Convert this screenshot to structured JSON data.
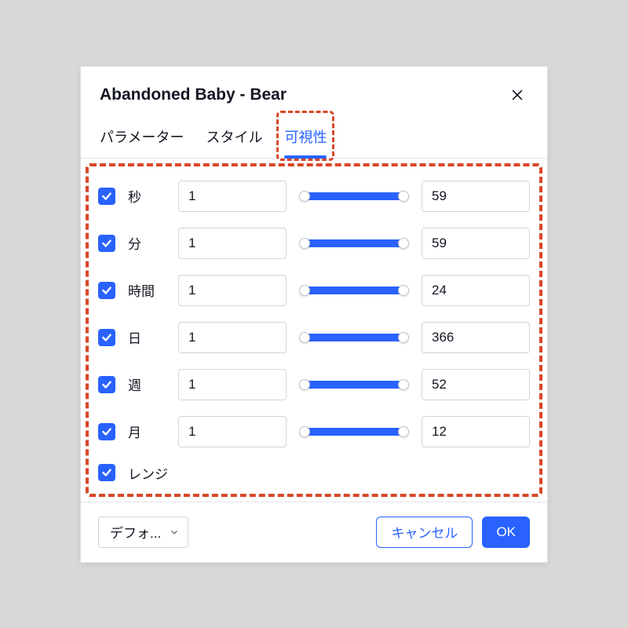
{
  "dialog": {
    "title": "Abandoned Baby - Bear"
  },
  "tabs": {
    "parameters": "パラメーター",
    "style": "スタイル",
    "visibility": "可視性"
  },
  "rows": [
    {
      "label": "秒",
      "min": "1",
      "max": "59"
    },
    {
      "label": "分",
      "min": "1",
      "max": "59"
    },
    {
      "label": "時間",
      "min": "1",
      "max": "24"
    },
    {
      "label": "日",
      "min": "1",
      "max": "366"
    },
    {
      "label": "週",
      "min": "1",
      "max": "52"
    },
    {
      "label": "月",
      "min": "1",
      "max": "12"
    }
  ],
  "range": {
    "label": "レンジ"
  },
  "footer": {
    "dropdown": "デフォ...",
    "cancel": "キャンセル",
    "ok": "OK"
  }
}
